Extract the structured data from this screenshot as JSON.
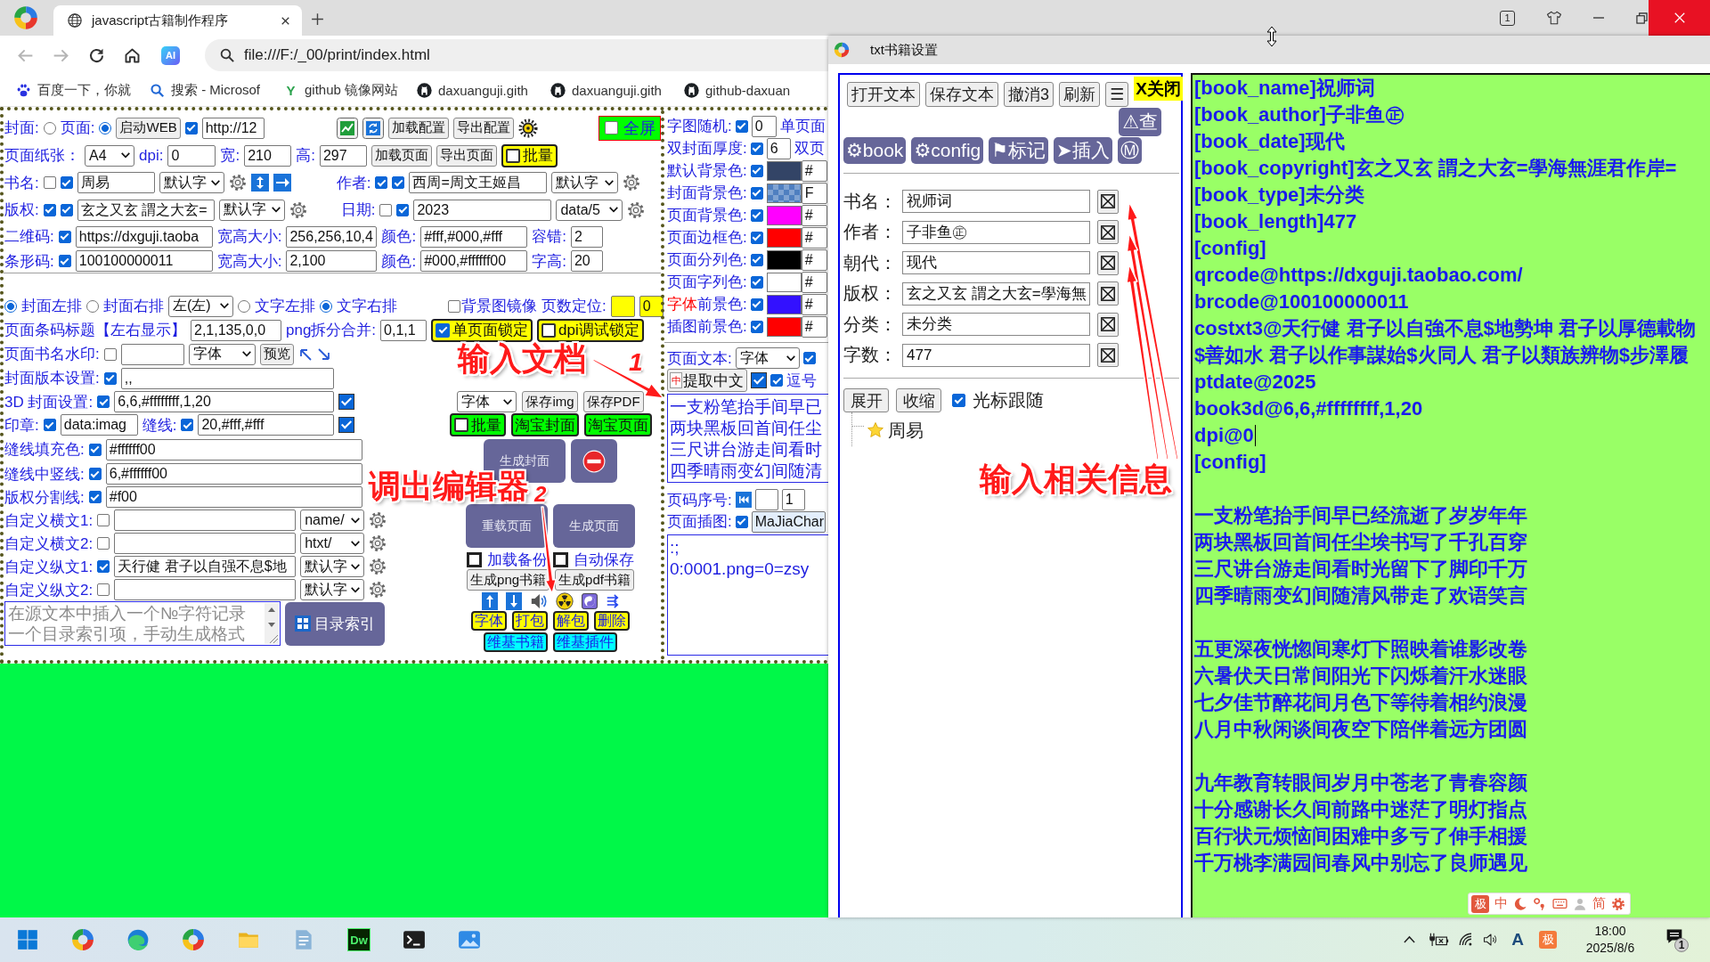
{
  "browser": {
    "tab": {
      "title": "javascript古籍制作程序"
    },
    "window_buttons": [
      {
        "kind": "counter",
        "label": "1"
      },
      {
        "kind": "shirt"
      },
      {
        "kind": "minimize"
      },
      {
        "kind": "restore"
      },
      {
        "kind": "close"
      }
    ],
    "nav": [
      {
        "kind": "back",
        "disabled": true
      },
      {
        "kind": "forward",
        "disabled": true
      },
      {
        "kind": "reload",
        "disabled": false
      },
      {
        "kind": "home",
        "disabled": false
      }
    ],
    "assistant": "AI",
    "address": "file:///F:/_00/print/index.html",
    "bookmarks": [
      {
        "kind": "paw",
        "label": "百度一下，你就"
      },
      {
        "kind": "search",
        "label": "搜索 - Microsof"
      },
      {
        "kind": "letter",
        "glyph": "Y",
        "label": "github 镜像网站"
      },
      {
        "kind": "octocat",
        "label": "daxuanguji.gith"
      },
      {
        "kind": "octocat",
        "label": "daxuanguji.gith"
      },
      {
        "kind": "octocat",
        "label": "github-daxuan"
      }
    ]
  },
  "form": {
    "rows": [
      {
        "items": [
          {
            "kind": "label",
            "text": "封面:"
          },
          {
            "kind": "radio",
            "selected": false
          },
          {
            "kind": "label",
            "text": "页面:"
          },
          {
            "kind": "radio",
            "selected": true
          },
          {
            "kind": "button",
            "label": "启动WEB"
          },
          {
            "kind": "check",
            "checked": true
          },
          {
            "kind": "input",
            "value": "http://12"
          },
          {
            "kind": "chart"
          },
          {
            "kind": "refresh"
          },
          {
            "kind": "button",
            "label": "加载配置"
          },
          {
            "kind": "button",
            "label": "导出配置"
          },
          {
            "kind": "sun"
          },
          {
            "kind": "switch",
            "label": "全屏",
            "checked": false,
            "color": "#00ff00"
          }
        ]
      },
      {
        "items": [
          {
            "kind": "label",
            "text": "页面纸张："
          },
          {
            "kind": "select",
            "value": "A4"
          },
          {
            "kind": "label",
            "text": "dpi:"
          },
          {
            "kind": "input",
            "value": "0"
          },
          {
            "kind": "label",
            "text": "宽:"
          },
          {
            "kind": "input",
            "value": "210"
          },
          {
            "kind": "label",
            "text": "高:"
          },
          {
            "kind": "input",
            "value": "297"
          },
          {
            "kind": "button",
            "label": "加载页面"
          },
          {
            "kind": "button",
            "label": "导出页面"
          },
          {
            "kind": "toggle",
            "label": "批量",
            "checked": false,
            "color": "#ffff00"
          }
        ]
      },
      {
        "items": [
          {
            "kind": "label",
            "text": "书名:"
          },
          {
            "kind": "check",
            "checked": false
          },
          {
            "kind": "check",
            "checked": true
          },
          {
            "kind": "input",
            "value": "周易"
          },
          {
            "kind": "select",
            "value": "默认字"
          },
          {
            "kind": "gear"
          },
          {
            "kind": "updown"
          },
          {
            "kind": "right"
          },
          {
            "kind": "label",
            "text": "作者:"
          },
          {
            "kind": "check",
            "checked": true
          },
          {
            "kind": "check",
            "checked": true
          },
          {
            "kind": "input",
            "value": "西周=周文王姬昌"
          },
          {
            "kind": "select",
            "value": "默认字"
          },
          {
            "kind": "gear"
          }
        ]
      },
      {
        "items": [
          {
            "kind": "label",
            "text": "版权:"
          },
          {
            "kind": "check",
            "checked": true
          },
          {
            "kind": "check",
            "checked": true
          },
          {
            "kind": "input",
            "value": "玄之又玄 謂之大玄="
          },
          {
            "kind": "select",
            "value": "默认字"
          },
          {
            "kind": "gear"
          },
          {
            "kind": "label",
            "text": "日期:"
          },
          {
            "kind": "check",
            "checked": false
          },
          {
            "kind": "check",
            "checked": true
          },
          {
            "kind": "input",
            "value": "2023"
          },
          {
            "kind": "select",
            "value": "data/5"
          },
          {
            "kind": "gear"
          }
        ]
      },
      {
        "items": [
          {
            "kind": "label",
            "text": "二维码:"
          },
          {
            "kind": "check",
            "checked": true
          },
          {
            "kind": "input",
            "value": "https://dxguji.taoba"
          },
          {
            "kind": "label",
            "text": "宽高大小:"
          },
          {
            "kind": "input",
            "value": "256,256,10,4"
          },
          {
            "kind": "label",
            "text": "颜色:"
          },
          {
            "kind": "input",
            "value": "#fff,#000,#fff"
          },
          {
            "kind": "label",
            "text": "容错:"
          },
          {
            "kind": "input",
            "value": "2"
          }
        ]
      },
      {
        "items": [
          {
            "kind": "label",
            "text": "条形码:"
          },
          {
            "kind": "check",
            "checked": true
          },
          {
            "kind": "input",
            "value": "100100000011"
          },
          {
            "kind": "label",
            "text": "宽高大小:"
          },
          {
            "kind": "input",
            "value": "2,100"
          },
          {
            "kind": "label",
            "text": "颜色:"
          },
          {
            "kind": "input",
            "value": "#000,#ffffff00"
          },
          {
            "kind": "label",
            "text": "字高:"
          },
          {
            "kind": "input",
            "value": "20"
          }
        ]
      },
      {
        "items": [
          {
            "kind": "radio",
            "selected": true
          },
          {
            "kind": "label",
            "text": "封面左排"
          },
          {
            "kind": "radio",
            "selected": false
          },
          {
            "kind": "label",
            "text": "封面右排"
          },
          {
            "kind": "select",
            "value": "左(左)"
          },
          {
            "kind": "radio",
            "selected": false
          },
          {
            "kind": "label",
            "text": "文字左排"
          },
          {
            "kind": "radio",
            "selected": true
          },
          {
            "kind": "label",
            "text": "文字右排"
          },
          {
            "kind": "check",
            "checked": false
          },
          {
            "kind": "label",
            "text": "背景图镜像"
          },
          {
            "kind": "label",
            "text": "页数定位:"
          },
          {
            "kind": "input",
            "color": "#ffff00"
          },
          {
            "kind": "input",
            "value": "0",
            "color": "#ffff00"
          }
        ]
      },
      {
        "items": [
          {
            "kind": "label",
            "text": "页面条码标题【左右显示】"
          },
          {
            "kind": "input",
            "value": "2,1,135,0,0"
          },
          {
            "kind": "label",
            "text": "png拆分合并:"
          },
          {
            "kind": "input",
            "value": "0,1,1"
          },
          {
            "kind": "toggle",
            "label": "单页面锁定",
            "checked": true,
            "color": "#ffff00"
          },
          {
            "kind": "toggle",
            "label": "dpi调试锁定",
            "checked": false,
            "color": "#ffff00"
          }
        ]
      },
      {
        "items": [
          {
            "kind": "label",
            "text": "页面书名水印:"
          },
          {
            "kind": "check",
            "checked": false
          },
          {
            "kind": "input"
          },
          {
            "kind": "select",
            "value": "字体"
          },
          {
            "kind": "button",
            "label": "预览"
          },
          {
            "kind": "upleft"
          },
          {
            "kind": "downright"
          }
        ]
      },
      {
        "items": [
          {
            "kind": "label",
            "text": "封面版本设置:"
          },
          {
            "kind": "check",
            "checked": true
          },
          {
            "kind": "input",
            "value": ",,"
          }
        ]
      },
      {
        "items": [
          {
            "kind": "label",
            "text": "3D 封面设置:"
          },
          {
            "kind": "check",
            "checked": true
          },
          {
            "kind": "input",
            "value": "6,6,#ffffffff,1,20"
          },
          {
            "kind": "box",
            "checked": true
          }
        ]
      },
      {
        "items": [
          {
            "kind": "label",
            "text": "印章:"
          },
          {
            "kind": "check",
            "checked": true
          },
          {
            "kind": "input",
            "value": "data:imag"
          },
          {
            "kind": "label",
            "text": "缝线:"
          },
          {
            "kind": "check",
            "checked": true
          },
          {
            "kind": "input",
            "value": "20,#fff,#fff"
          },
          {
            "kind": "box",
            "checked": true
          }
        ]
      },
      {
        "items": [
          {
            "kind": "label",
            "text": "缝线填充色:"
          },
          {
            "kind": "check",
            "checked": true
          },
          {
            "kind": "input",
            "value": "#ffffff00"
          }
        ]
      },
      {
        "items": [
          {
            "kind": "label",
            "text": "缝线中竖线:"
          },
          {
            "kind": "check",
            "checked": true
          },
          {
            "kind": "input",
            "value": "6,#ffffff00"
          }
        ]
      },
      {
        "items": [
          {
            "kind": "label",
            "text": "版权分割线:"
          },
          {
            "kind": "check",
            "checked": true
          },
          {
            "kind": "input",
            "value": "#f00"
          }
        ]
      },
      {
        "items": [
          {
            "kind": "label",
            "text": "自定义横文1:"
          },
          {
            "kind": "check",
            "checked": false
          },
          {
            "kind": "input"
          },
          {
            "kind": "select",
            "value": "name/"
          },
          {
            "kind": "gear"
          }
        ]
      },
      {
        "items": [
          {
            "kind": "label",
            "text": "自定义横文2:"
          },
          {
            "kind": "check",
            "checked": false
          },
          {
            "kind": "input"
          },
          {
            "kind": "select",
            "value": "htxt/"
          },
          {
            "kind": "gear"
          }
        ]
      },
      {
        "items": [
          {
            "kind": "label",
            "text": "自定义纵文1:"
          },
          {
            "kind": "check",
            "checked": true
          },
          {
            "kind": "input",
            "value": "天行健 君子以自强不息$地"
          },
          {
            "kind": "select",
            "value": "默认字"
          },
          {
            "kind": "gear"
          }
        ]
      },
      {
        "items": [
          {
            "kind": "label",
            "text": "自定义纵文2:"
          },
          {
            "kind": "check",
            "checked": false
          },
          {
            "kind": "input"
          },
          {
            "kind": "select",
            "value": "默认字"
          },
          {
            "kind": "gear"
          }
        ]
      },
      {
        "items": [
          {
            "kind": "textarea",
            "placeholder": "在源文本中插入一个№字符记录一个目录索引项，手动生成格式"
          },
          {
            "kind": "gridtile",
            "label": "目录索引"
          }
        ]
      }
    ]
  },
  "actions": {
    "rows": [
      {
        "items": [
          {
            "kind": "select",
            "value": "字体"
          },
          {
            "kind": "button",
            "label": "保存img"
          },
          {
            "kind": "button",
            "label": "保存PDF"
          }
        ]
      },
      {
        "items": [
          {
            "kind": "toggle",
            "label": "批量",
            "checked": false,
            "color": "#00ff00"
          },
          {
            "kind": "button",
            "label": "淘宝封面",
            "color": "#00ff00"
          },
          {
            "kind": "button",
            "label": "淘宝页面",
            "color": "#00ff00"
          }
        ]
      },
      {
        "items": [
          {
            "kind": "tile",
            "label": "生成封面"
          },
          {
            "kind": "minustile"
          }
        ]
      },
      {
        "items": [
          {
            "kind": "tile",
            "label": "重载页面"
          },
          {
            "kind": "tile",
            "label": "生成页面"
          }
        ]
      },
      {
        "items": [
          {
            "kind": "boxlabel",
            "label": "加载备份",
            "checked": false
          },
          {
            "kind": "boxlabel",
            "label": "自动保存",
            "checked": false
          }
        ]
      },
      {
        "items": [
          {
            "kind": "button",
            "label": "生成png书籍"
          },
          {
            "kind": "button",
            "label": "生成pdf书籍"
          }
        ]
      },
      {
        "items": [
          {
            "kind": "up"
          },
          {
            "kind": "down"
          },
          {
            "kind": "speaker"
          },
          {
            "kind": "hazard"
          },
          {
            "kind": "yinyang"
          },
          {
            "kind": "doublearrow"
          }
        ]
      },
      {
        "items": [
          {
            "kind": "button",
            "label": "字体",
            "color": "#ffff00"
          },
          {
            "kind": "button",
            "label": "打包",
            "color": "#ffff00"
          },
          {
            "kind": "button",
            "label": "解包",
            "color": "#ffff00"
          },
          {
            "kind": "button",
            "label": "删除",
            "color": "#ffff00"
          }
        ]
      },
      {
        "items": [
          {
            "kind": "button",
            "label": "维基书籍",
            "color": "#00ffff"
          },
          {
            "kind": "button",
            "label": "维基插件",
            "color": "#00ffff"
          }
        ]
      }
    ]
  },
  "side": {
    "rows": [
      {
        "items": [
          {
            "kind": "label",
            "text": "字图随机:"
          },
          {
            "kind": "check",
            "checked": true
          },
          {
            "kind": "input",
            "value": "0"
          },
          {
            "kind": "label",
            "text": "单页面"
          }
        ]
      },
      {
        "items": [
          {
            "kind": "label",
            "text": "双封面厚度:"
          },
          {
            "kind": "check",
            "checked": true
          },
          {
            "kind": "input",
            "value": "6"
          },
          {
            "kind": "label",
            "text": "双页"
          }
        ]
      },
      {
        "items": [
          {
            "kind": "label",
            "text": "默认背景色:"
          },
          {
            "kind": "check",
            "checked": true
          },
          {
            "kind": "swatch",
            "color": "#334466"
          },
          {
            "kind": "input",
            "value": "#"
          }
        ]
      },
      {
        "items": [
          {
            "kind": "label",
            "text": "封面背景色:"
          },
          {
            "kind": "check",
            "checked": true
          },
          {
            "kind": "tiles",
            "color": "#4f7fc0"
          },
          {
            "kind": "input",
            "value": "F"
          }
        ]
      },
      {
        "items": [
          {
            "kind": "label",
            "text": "页面背景色:"
          },
          {
            "kind": "check",
            "checked": true
          },
          {
            "kind": "swatch",
            "color": "#ff00ff"
          },
          {
            "kind": "input",
            "value": "#"
          }
        ]
      },
      {
        "items": [
          {
            "kind": "label",
            "text": "页面边框色:"
          },
          {
            "kind": "check",
            "checked": true
          },
          {
            "kind": "swatch",
            "color": "#ff0000"
          },
          {
            "kind": "input",
            "value": "#"
          }
        ]
      },
      {
        "items": [
          {
            "kind": "label",
            "text": "页面分列色:"
          },
          {
            "kind": "check",
            "checked": true
          },
          {
            "kind": "swatch",
            "color": "#000000"
          },
          {
            "kind": "input",
            "value": "#"
          }
        ]
      },
      {
        "items": [
          {
            "kind": "label",
            "text": "页面字列色:"
          },
          {
            "kind": "check",
            "checked": true
          },
          {
            "kind": "swatch",
            "color": "#ffffff"
          },
          {
            "kind": "input",
            "value": "#"
          }
        ]
      },
      {
        "items": [
          {
            "kind": "label",
            "text": "字体",
            "color": "#ff0000"
          },
          {
            "kind": "label",
            "text": "前景色:"
          },
          {
            "kind": "check",
            "checked": true
          },
          {
            "kind": "swatch",
            "color": "#3311ff"
          },
          {
            "kind": "input",
            "value": "#"
          }
        ]
      },
      {
        "items": [
          {
            "kind": "label",
            "text": "插图前景色:"
          },
          {
            "kind": "check",
            "checked": true
          },
          {
            "kind": "swatch",
            "color": "#ff0000"
          },
          {
            "kind": "input",
            "value": "#"
          }
        ]
      },
      {
        "items": [
          {
            "kind": "label",
            "text": "页面文本:"
          },
          {
            "kind": "select",
            "value": "字体"
          },
          {
            "kind": "check",
            "checked": true
          }
        ]
      },
      {
        "items": [
          {
            "kind": "button",
            "label": "提取中文",
            "badge": "中"
          },
          {
            "kind": "box",
            "checked": true
          },
          {
            "kind": "check",
            "checked": true
          },
          {
            "kind": "label",
            "text": "逗号"
          }
        ]
      },
      {
        "items": [
          {
            "kind": "textarea",
            "lines": [
              "一支粉笔抬手间早已",
              "两块黑板回首间任尘",
              "三尺讲台游走间看时",
              "四季晴雨变幻间随清"
            ]
          }
        ]
      },
      {
        "items": [
          {
            "kind": "label",
            "text": "页码序号:"
          },
          {
            "kind": "first"
          },
          {
            "kind": "input"
          },
          {
            "kind": "input",
            "value": "1"
          }
        ]
      },
      {
        "items": [
          {
            "kind": "label",
            "text": "页面插图:"
          },
          {
            "kind": "check",
            "checked": true
          },
          {
            "kind": "input",
            "value": "MaJiaChar",
            "color": "#e3eefc"
          }
        ]
      },
      {
        "items": [
          {
            "kind": "textarea",
            "lines": [
              ":;",
              "0:0001.png=0=zsy"
            ]
          }
        ]
      }
    ]
  },
  "dialog": {
    "title": "txt书籍设置",
    "toolbar": [
      "打开文本",
      "保存文本",
      "撤消3",
      "刷新",
      "☰"
    ],
    "close": "X关闭",
    "check": "⚠查",
    "tags": [
      "⚙book",
      "⚙config",
      "⚑标记",
      "➤插入",
      "Ⓜ"
    ],
    "fields": [
      {
        "label": "书名：",
        "value": "祝师词"
      },
      {
        "label": "作者：",
        "value": "子非鱼㊣"
      },
      {
        "label": "朝代：",
        "value": "现代"
      },
      {
        "label": "版权：",
        "value": "玄之又玄 謂之大玄=學海無"
      },
      {
        "label": "分类：",
        "value": "未分类"
      },
      {
        "label": "字数：",
        "value": "477"
      }
    ],
    "tree_buttons": [
      "展开",
      "收缩"
    ],
    "follow": {
      "label": "光标跟随",
      "checked": true
    },
    "tree": [
      {
        "label": "周易"
      }
    ]
  },
  "editor": {
    "paragraphs": [
      {
        "lines": [
          {
            "text": "[book_name]祝师词",
            "caret": false
          },
          {
            "text": "[book_author]子非鱼㊣",
            "caret": false
          },
          {
            "text": "[book_date]现代",
            "caret": false
          },
          {
            "text": "[book_copyright]玄之又玄 謂之大玄=學海無涯君作岸=",
            "caret": false
          },
          {
            "text": "[book_type]未分类",
            "caret": false
          },
          {
            "text": "[book_length]477",
            "caret": false
          },
          {
            "text": "[config]",
            "caret": false
          },
          {
            "text": "qrcode@https://dxguji.taobao.com/",
            "caret": false
          },
          {
            "text": "brcode@100100000011",
            "caret": false
          },
          {
            "text": "costxt3@天行健 君子以自強不息$地勢坤 君子以厚德載物",
            "caret": false
          },
          {
            "text": "$善如水 君子以作事謀始$火同人 君子以類族辨物$步澤履",
            "caret": false
          },
          {
            "text": "ptdate@2025",
            "caret": false
          },
          {
            "text": "book3d@6,6,#ffffffff,1,20",
            "caret": false
          },
          {
            "text": "dpi@0",
            "caret": true
          },
          {
            "text": "[config]",
            "caret": false
          }
        ]
      },
      {
        "lines": [
          {
            "text": "一支粉笔抬手间早已经流逝了岁岁年年",
            "caret": false
          },
          {
            "text": "两块黑板回首间任尘埃书写了千孔百穿",
            "caret": false
          },
          {
            "text": "三尺讲台游走间看时光留下了脚印千万",
            "caret": false
          },
          {
            "text": "四季晴雨变幻间随清风带走了欢语笑言",
            "caret": false
          }
        ]
      },
      {
        "lines": [
          {
            "text": "五更深夜恍惚间寒灯下照映着谁影改卷",
            "caret": false
          },
          {
            "text": "六暑伏天日常间阳光下闪烁着汗水迷眼",
            "caret": false
          },
          {
            "text": "七夕佳节醉花间月色下等待着相约浪漫",
            "caret": false
          },
          {
            "text": "八月中秋闲谈间夜空下陪伴着远方团圆",
            "caret": false
          }
        ]
      },
      {
        "lines": [
          {
            "text": "九年教育转眼间岁月中苍老了青春容颜",
            "caret": false
          },
          {
            "text": "十分感谢长久间前路中迷茫了明灯指点",
            "caret": false
          },
          {
            "text": "百行状元烦恼间困难中多亏了伸手相援",
            "caret": false
          },
          {
            "text": "千万桃李满园间春风中别忘了良师遇见",
            "caret": false
          }
        ]
      }
    ]
  },
  "ime_bar": {
    "logo": "极",
    "mode": "中",
    "script": "简"
  },
  "taskbar": {
    "apps": [
      {
        "kind": "start"
      },
      {
        "kind": "ring"
      },
      {
        "kind": "edge"
      },
      {
        "kind": "ring"
      },
      {
        "kind": "folder"
      },
      {
        "kind": "book"
      },
      {
        "kind": "dw",
        "label": "Dw"
      },
      {
        "kind": "terminal"
      },
      {
        "kind": "photos"
      }
    ],
    "tray": {
      "font": "A",
      "ime": "极",
      "time": "18:00",
      "date": "2025/8/6",
      "notifications": "1"
    }
  },
  "annotations": [
    {
      "text": "输入文档",
      "number": "1"
    },
    {
      "text": "调出编辑器",
      "number": "2"
    },
    {
      "text": "输入相关信息"
    }
  ]
}
